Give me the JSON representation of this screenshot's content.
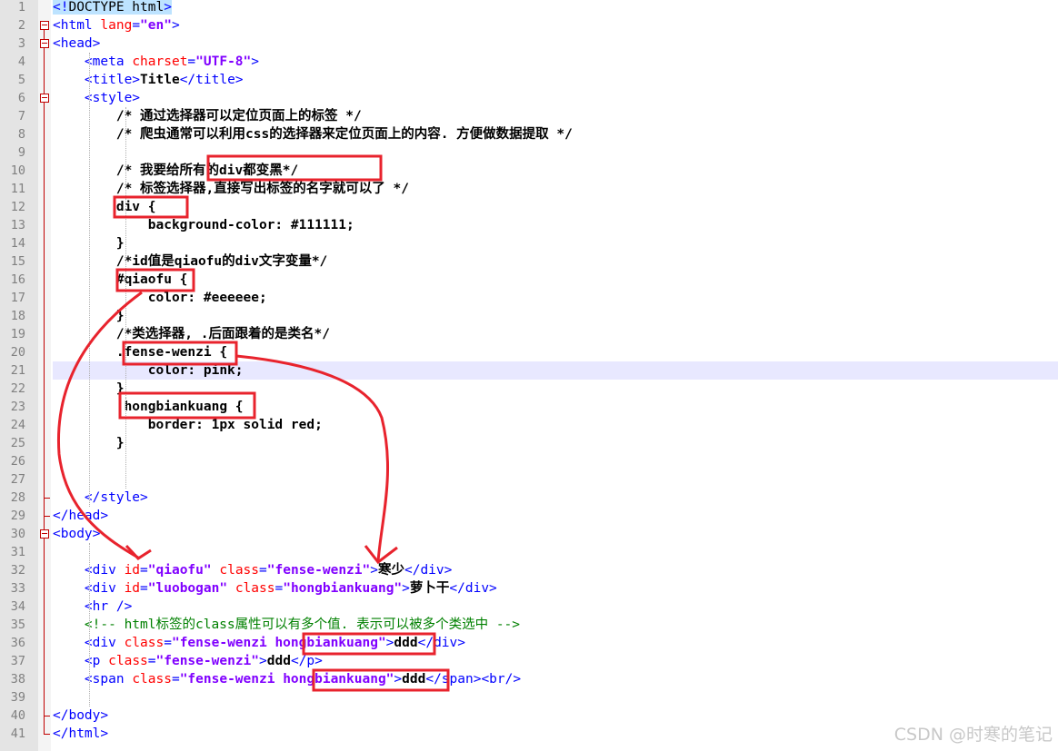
{
  "editor": {
    "lines": [
      [
        {
          "t": "<!",
          "c": "tag doctype"
        },
        {
          "t": "DOCTYPE html",
          "c": "doctype"
        },
        {
          "t": ">",
          "c": "tag doctype"
        }
      ],
      [
        {
          "t": "<html ",
          "c": "tag"
        },
        {
          "t": "lang",
          "c": "attr"
        },
        {
          "t": "=",
          "c": "tag"
        },
        {
          "t": "\"en\"",
          "c": "str"
        },
        {
          "t": ">",
          "c": "tag"
        }
      ],
      [
        {
          "t": "<head>",
          "c": "tag"
        }
      ],
      [
        {
          "t": "    "
        },
        {
          "t": "<meta ",
          "c": "tag"
        },
        {
          "t": "charset",
          "c": "attr"
        },
        {
          "t": "=",
          "c": "tag"
        },
        {
          "t": "\"UTF-8\"",
          "c": "str"
        },
        {
          "t": ">",
          "c": "tag"
        }
      ],
      [
        {
          "t": "    "
        },
        {
          "t": "<title>",
          "c": "tag"
        },
        {
          "t": "Title",
          "c": "bold"
        },
        {
          "t": "</title>",
          "c": "tag"
        }
      ],
      [
        {
          "t": "    "
        },
        {
          "t": "<style>",
          "c": "tag"
        }
      ],
      [
        {
          "t": "        /* 通过选择器可以定位页面上的标签 */",
          "c": "bold"
        }
      ],
      [
        {
          "t": "        /* 爬虫通常可以利用css的选择器来定位页面上的内容. 方便做数据提取 */",
          "c": "bold"
        }
      ],
      [],
      [
        {
          "t": "        /* 我要给所有的div都变黑*/",
          "c": "bold"
        }
      ],
      [
        {
          "t": "        /* 标签选择器,直接写出标签的名字就可以了 */",
          "c": "bold"
        }
      ],
      [
        {
          "t": "        div {",
          "c": "bold"
        }
      ],
      [
        {
          "t": "            background-color: #111111;",
          "c": "bold"
        }
      ],
      [
        {
          "t": "        }",
          "c": "bold"
        }
      ],
      [
        {
          "t": "        /*id值是qiaofu的div文字变量*/",
          "c": "bold"
        }
      ],
      [
        {
          "t": "        #qiaofu {",
          "c": "bold"
        }
      ],
      [
        {
          "t": "            color: #eeeeee;",
          "c": "bold"
        }
      ],
      [
        {
          "t": "        }",
          "c": "bold"
        }
      ],
      [
        {
          "t": "        /*类选择器, .后面跟着的是类名*/",
          "c": "bold"
        }
      ],
      [
        {
          "t": "        .fense-wenzi {",
          "c": "bold"
        }
      ],
      [
        {
          "t": "            color: pink;",
          "c": "bold"
        }
      ],
      [
        {
          "t": "        }",
          "c": "bold"
        }
      ],
      [
        {
          "t": "        .hongbiankuang {",
          "c": "bold"
        }
      ],
      [
        {
          "t": "            border: 1px solid red;",
          "c": "bold"
        }
      ],
      [
        {
          "t": "        }",
          "c": "bold"
        }
      ],
      [],
      [],
      [
        {
          "t": "    "
        },
        {
          "t": "</style>",
          "c": "tag"
        }
      ],
      [
        {
          "t": "</head>",
          "c": "tag"
        }
      ],
      [
        {
          "t": "<body>",
          "c": "tag"
        }
      ],
      [],
      [
        {
          "t": "    "
        },
        {
          "t": "<div ",
          "c": "tag"
        },
        {
          "t": "id",
          "c": "attr"
        },
        {
          "t": "=",
          "c": "tag"
        },
        {
          "t": "\"qiaofu\"",
          "c": "str"
        },
        {
          "t": " class",
          "c": "attr"
        },
        {
          "t": "=",
          "c": "tag"
        },
        {
          "t": "\"fense-wenzi\"",
          "c": "str"
        },
        {
          "t": ">",
          "c": "tag"
        },
        {
          "t": "寒少",
          "c": "bold"
        },
        {
          "t": "</div>",
          "c": "tag"
        }
      ],
      [
        {
          "t": "    "
        },
        {
          "t": "<div ",
          "c": "tag"
        },
        {
          "t": "id",
          "c": "attr"
        },
        {
          "t": "=",
          "c": "tag"
        },
        {
          "t": "\"luobogan\"",
          "c": "str"
        },
        {
          "t": " class",
          "c": "attr"
        },
        {
          "t": "=",
          "c": "tag"
        },
        {
          "t": "\"hongbiankuang\"",
          "c": "str"
        },
        {
          "t": ">",
          "c": "tag"
        },
        {
          "t": "萝卜干",
          "c": "bold"
        },
        {
          "t": "</div>",
          "c": "tag"
        }
      ],
      [
        {
          "t": "    "
        },
        {
          "t": "<hr />",
          "c": "tag"
        }
      ],
      [
        {
          "t": "    "
        },
        {
          "t": "<!-- html标签的class属性可以有多个值. 表示可以被多个类选中 -->",
          "c": "cmt"
        }
      ],
      [
        {
          "t": "    "
        },
        {
          "t": "<div ",
          "c": "tag"
        },
        {
          "t": "class",
          "c": "attr"
        },
        {
          "t": "=",
          "c": "tag"
        },
        {
          "t": "\"fense-wenzi hongbiankuang\"",
          "c": "str"
        },
        {
          "t": ">",
          "c": "tag"
        },
        {
          "t": "ddd",
          "c": "bold"
        },
        {
          "t": "</div>",
          "c": "tag"
        }
      ],
      [
        {
          "t": "    "
        },
        {
          "t": "<p ",
          "c": "tag"
        },
        {
          "t": "class",
          "c": "attr"
        },
        {
          "t": "=",
          "c": "tag"
        },
        {
          "t": "\"fense-wenzi\"",
          "c": "str"
        },
        {
          "t": ">",
          "c": "tag"
        },
        {
          "t": "ddd",
          "c": "bold"
        },
        {
          "t": "</p>",
          "c": "tag"
        }
      ],
      [
        {
          "t": "    "
        },
        {
          "t": "<span ",
          "c": "tag"
        },
        {
          "t": "class",
          "c": "attr"
        },
        {
          "t": "=",
          "c": "tag"
        },
        {
          "t": "\"fense-wenzi hongbiankuang\"",
          "c": "str"
        },
        {
          "t": ">",
          "c": "tag"
        },
        {
          "t": "ddd",
          "c": "bold"
        },
        {
          "t": "</span><br/>",
          "c": "tag"
        }
      ],
      [],
      [
        {
          "t": "</body>",
          "c": "tag"
        }
      ],
      [
        {
          "t": "</html>",
          "c": "tag"
        }
      ]
    ],
    "current_line": 21
  },
  "watermark": "CSDN @时寒的笔记",
  "annotations": {
    "color": "#e8232d",
    "boxes_label": "red highlight boxes",
    "arrows_label": "red arrows"
  }
}
